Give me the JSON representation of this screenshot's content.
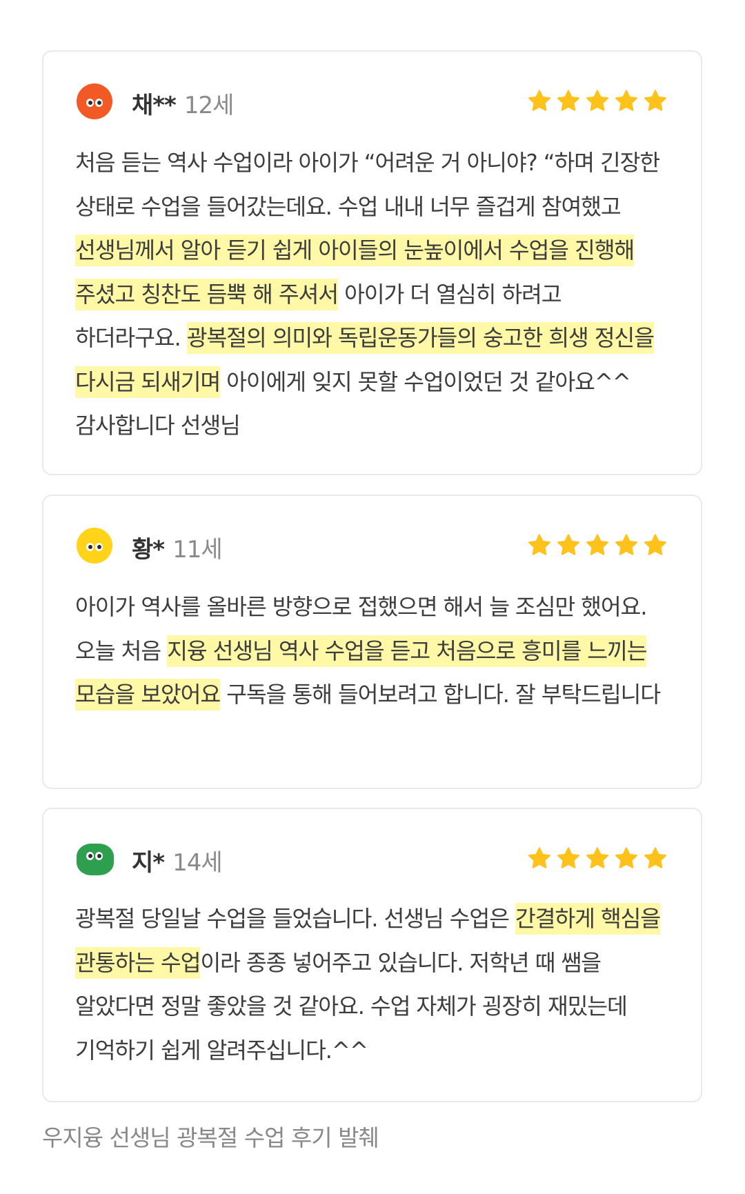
{
  "colors": {
    "avatar_orange": "#f15a24",
    "avatar_yellow": "#ffd31a",
    "avatar_green": "#2e9e4f",
    "star": "#ffc21a",
    "highlight": "#fff8a6"
  },
  "reviews": [
    {
      "name": "채**",
      "age": "12세",
      "rating": 5,
      "segments": [
        {
          "text": "처음 듣는 역사 수업이라 아이가 “어려운 거 아니야? “하며 긴장한 상태로 수업을 들어갔는데요. 수업 내내 너무 즐겁게 참여했고 "
        },
        {
          "text": "선생님께서 알아 듣기 쉽게 아이들의 눈높이에서 수업을 진행해 주셨고 칭찬도 듬뿍 해 주셔서"
        },
        {
          "text": " 아이가 더 열심히 하려고 하더라구요. "
        },
        {
          "text": "광복절의 의미와 독립운동가들의 숭고한 희생 정신을 다시금 되새기며"
        },
        {
          "text": " 아이에게 잊지 못할 수업이었던 것 같아요^^ 감사합니다 선생님"
        }
      ]
    },
    {
      "name": "황*",
      "age": "11세",
      "rating": 5,
      "segments": [
        {
          "text": "아이가 역사를 올바른 방향으로 접했으면 해서 늘 조심만 했어요. 오늘 처음 "
        },
        {
          "text": "지융 선생님 역사 수업을 듣고 처음으로 흥미를 느끼는 모습을 보았어요"
        },
        {
          "text": " 구독을 통해 들어보려고 합니다. 잘 부탁드립니다"
        }
      ]
    },
    {
      "name": "지*",
      "age": "14세",
      "rating": 5,
      "segments": [
        {
          "text": "광복절 당일날 수업을 들었습니다. 선생님 수업은 "
        },
        {
          "text": "간결하게 핵심을 관통하는 수업"
        },
        {
          "text": "이라 종종 넣어주고 있습니다. 저학년 때 쌤을 알았다면 정말 좋았을 것 같아요. 수업 자체가 굉장히 재밌는데 기억하기 쉽게 알려주십니다.^^"
        }
      ]
    }
  ],
  "footer": {
    "caption": "우지융 선생님 광복절 수업 후기 발췌"
  }
}
